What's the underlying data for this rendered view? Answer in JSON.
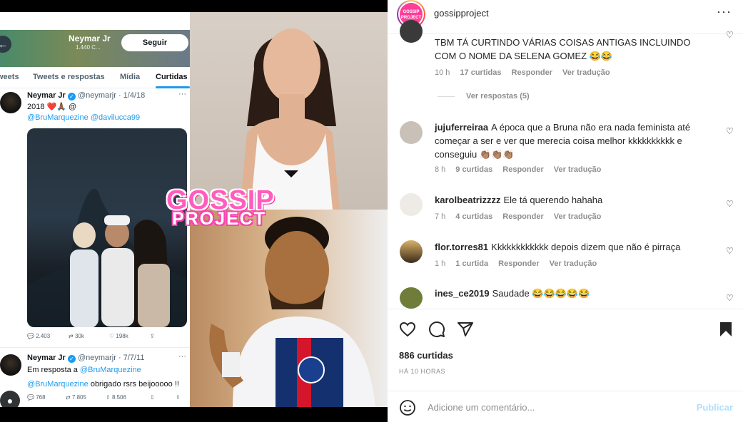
{
  "twitter": {
    "profile_name": "Neymar Jr",
    "profile_count": "1.440 C...",
    "follow_label": "Seguir",
    "back_icon": "arrow-left-icon",
    "tabs": [
      "weets",
      "Tweets e respostas",
      "Mídia",
      "Curtidas"
    ],
    "tweet1": {
      "name": "Neymar Jr",
      "handle": "@neymarjr · 1/4/18",
      "line1": "2018 ❤️🙏🏾 @",
      "line2": "@BruMarquezine @davilucca99",
      "replies": "2.403",
      "retweets": "30k",
      "likes": "198k"
    },
    "tweet2": {
      "name": "Neymar Jr",
      "handle": "@neymarjr · 7/7/11",
      "reply_prefix": "Em resposta a ",
      "reply_to": "@BruMarquezine",
      "text_mention": "@BruMarquezine",
      "text": " obrigado rsrs beijooooo !!",
      "replies": "768",
      "retweets": "7.805",
      "likes": "8.506"
    }
  },
  "overlay": {
    "line1": "GOSSIP",
    "line2": "PROJECT"
  },
  "instagram": {
    "username": "gossipproject",
    "logo_text": "GOSSIP PROJECT",
    "more_icon": "more-dots-icon",
    "comments": [
      {
        "username": "",
        "text": "TBM TÁ CURTINDO VÁRIAS COISAS ANTIGAS INCLUINDO COM O NOME DA SELENA GOMEZ 😂😂",
        "time": "10 h",
        "likes": "17 curtidas",
        "reply": "Responder",
        "translate": "Ver tradução"
      },
      {
        "username": "jujuferreiraa",
        "text": "A época que a Bruna não era nada feminista até começar a ser e ver que merecia coisa melhor kkkkkkkkkk e conseguiu 👏🏽👏🏽👏🏽",
        "time": "8 h",
        "likes": "9 curtidas",
        "reply": "Responder",
        "translate": "Ver tradução"
      },
      {
        "username": "karolbeatrizzzz",
        "text": "Ele tá querendo hahaha",
        "time": "7 h",
        "likes": "4 curtidas",
        "reply": "Responder",
        "translate": "Ver tradução"
      },
      {
        "username": "flor.torres81",
        "text": "Kkkkkkkkkkkk depois dizem que não é pirraça",
        "time": "1 h",
        "likes": "1 curtida",
        "reply": "Responder",
        "translate": "Ver tradução"
      },
      {
        "username": "ines_ce2019",
        "text": "Saudade 😂😂😂😂😂",
        "time": "",
        "likes": "",
        "reply": "",
        "translate": ""
      }
    ],
    "view_replies": "Ver respostas (5)",
    "likes_count": "886 curtidas",
    "posted_time": "HÁ 10 HORAS",
    "comment_placeholder": "Adicione um comentário...",
    "publish_label": "Publicar",
    "icons": [
      "heart-icon",
      "comment-icon",
      "share-icon",
      "bookmark-icon",
      "emoji-icon"
    ],
    "colors": {
      "publish": "#b2dffc",
      "muted": "#8e8e8e",
      "text": "#262626"
    }
  }
}
